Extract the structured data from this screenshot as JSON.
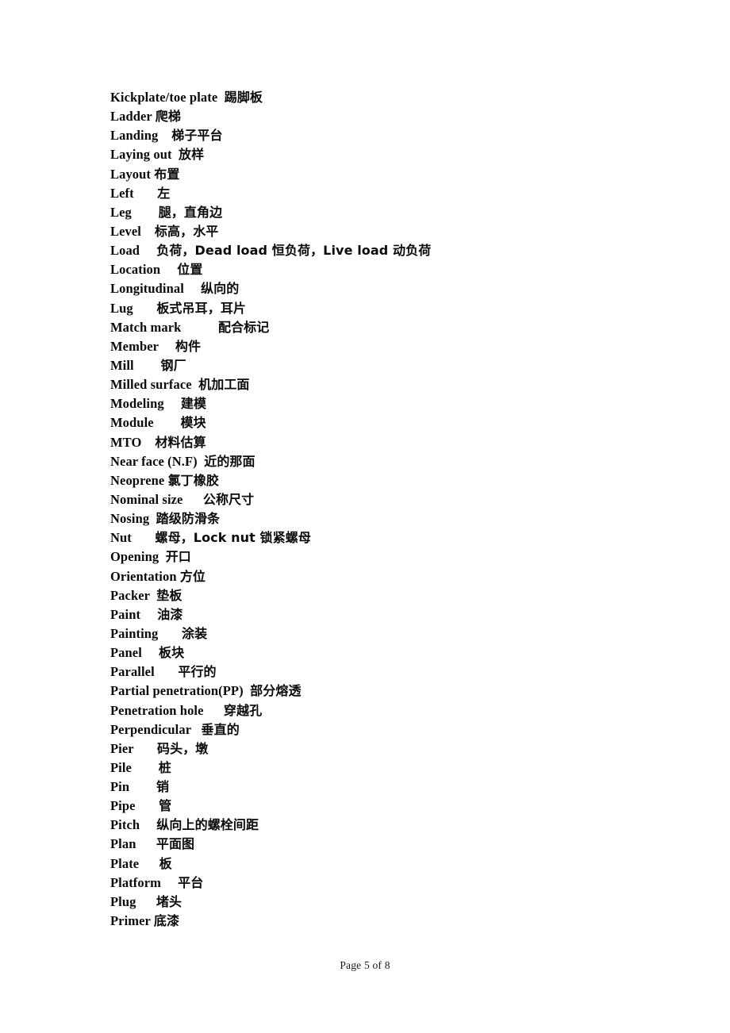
{
  "document": {
    "type": "glossary",
    "language_pair": "English-Chinese",
    "background_color": "#ffffff",
    "text_color": "#000000"
  },
  "body": {
    "entries": [
      {
        "term": "Kickplate/toe plate",
        "gap": "  ",
        "translation": "踢脚板"
      },
      {
        "term": "Ladder",
        "gap": " ",
        "translation": "爬梯"
      },
      {
        "term": "Landing",
        "gap": "    ",
        "translation": "梯子平台"
      },
      {
        "term": "Laying out",
        "gap": "  ",
        "translation": "放样"
      },
      {
        "term": "Layout",
        "gap": " ",
        "translation": "布置"
      },
      {
        "term": "Left",
        "gap": "       ",
        "translation": "左"
      },
      {
        "term": "Leg",
        "gap": "        ",
        "translation": "腿，直角边"
      },
      {
        "term": "Level",
        "gap": "    ",
        "translation": "标高，水平"
      },
      {
        "term": "Load",
        "gap": "     ",
        "translation": "负荷，Dead load 恒负荷，Live load 动负荷"
      },
      {
        "term": "Location",
        "gap": "     ",
        "translation": "位置"
      },
      {
        "term": "Longitudinal",
        "gap": "     ",
        "translation": "纵向的"
      },
      {
        "term": "Lug",
        "gap": "       ",
        "translation": "板式吊耳，耳片"
      },
      {
        "term": "Match mark",
        "gap": "           ",
        "translation": "配合标记"
      },
      {
        "term": "Member",
        "gap": "     ",
        "translation": "构件"
      },
      {
        "term": "Mill",
        "gap": "        ",
        "translation": "钢厂"
      },
      {
        "term": "Milled surface",
        "gap": "  ",
        "translation": "机加工面"
      },
      {
        "term": "Modeling",
        "gap": "     ",
        "translation": "建模"
      },
      {
        "term": "Module",
        "gap": "        ",
        "translation": "模块"
      },
      {
        "term": "MTO",
        "gap": "    ",
        "translation": "材料估算"
      },
      {
        "term": "Near face (N.F)",
        "gap": "  ",
        "translation": "近的那面"
      },
      {
        "term": "Neoprene",
        "gap": " ",
        "translation": "氯丁橡胶"
      },
      {
        "term": "Nominal size",
        "gap": "      ",
        "translation": "公称尺寸"
      },
      {
        "term": "Nosing",
        "gap": "  ",
        "translation": "踏级防滑条"
      },
      {
        "term": "Nut",
        "gap": "       ",
        "translation": "螺母，Lock nut 锁紧螺母"
      },
      {
        "term": "Opening",
        "gap": "  ",
        "translation": "开口"
      },
      {
        "term": "Orientation",
        "gap": " ",
        "translation": "方位"
      },
      {
        "term": "Packer",
        "gap": "  ",
        "translation": "垫板"
      },
      {
        "term": "Paint",
        "gap": "     ",
        "translation": "油漆"
      },
      {
        "term": "Painting",
        "gap": "       ",
        "translation": "涂装"
      },
      {
        "term": "Panel",
        "gap": "     ",
        "translation": "板块"
      },
      {
        "term": "Parallel",
        "gap": "       ",
        "translation": "平行的"
      },
      {
        "term": "Partial penetration(PP)",
        "gap": "  ",
        "translation": "部分熔透"
      },
      {
        "term": "Penetration hole",
        "gap": "      ",
        "translation": "穿越孔"
      },
      {
        "term": "Perpendicular",
        "gap": "   ",
        "translation": "垂直的"
      },
      {
        "term": "Pier",
        "gap": "       ",
        "translation": "码头，墩"
      },
      {
        "term": "Pile",
        "gap": "        ",
        "translation": "桩"
      },
      {
        "term": "Pin",
        "gap": "        ",
        "translation": "销"
      },
      {
        "term": "Pipe",
        "gap": "       ",
        "translation": "管"
      },
      {
        "term": "Pitch",
        "gap": "     ",
        "translation": "纵向上的螺栓间距"
      },
      {
        "term": "Plan",
        "gap": "      ",
        "translation": "平面图"
      },
      {
        "term": "Plate",
        "gap": "      ",
        "translation": "板"
      },
      {
        "term": "Platform",
        "gap": "     ",
        "translation": "平台"
      },
      {
        "term": "Plug",
        "gap": "      ",
        "translation": "堵头"
      },
      {
        "term": "Primer",
        "gap": " ",
        "translation": "底漆"
      }
    ]
  },
  "footer": {
    "page_label": "Page 5 of 8",
    "current_page": 5,
    "total_pages": 8
  }
}
